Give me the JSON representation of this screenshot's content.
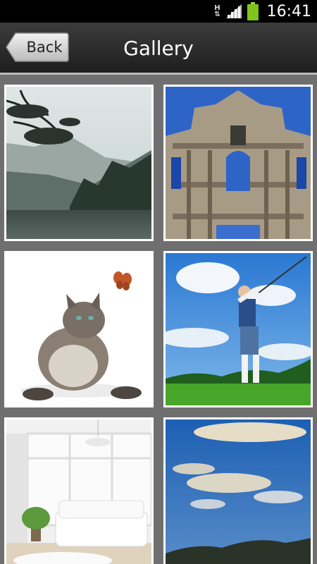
{
  "status_bar": {
    "network_type": "H",
    "network_arrows": "⇅",
    "time": "16:41",
    "icons": [
      "network-type-icon",
      "signal-icon",
      "battery-icon"
    ]
  },
  "header": {
    "back_label": "Back",
    "title": "Gallery"
  },
  "gallery": {
    "items": [
      {
        "icon": "lake-landscape-photo"
      },
      {
        "icon": "cathedral-ruins-photo"
      },
      {
        "icon": "cat-butterfly-photo"
      },
      {
        "icon": "golfer-photo"
      },
      {
        "icon": "white-living-room-photo"
      },
      {
        "icon": "blue-sky-clouds-photo"
      }
    ]
  }
}
